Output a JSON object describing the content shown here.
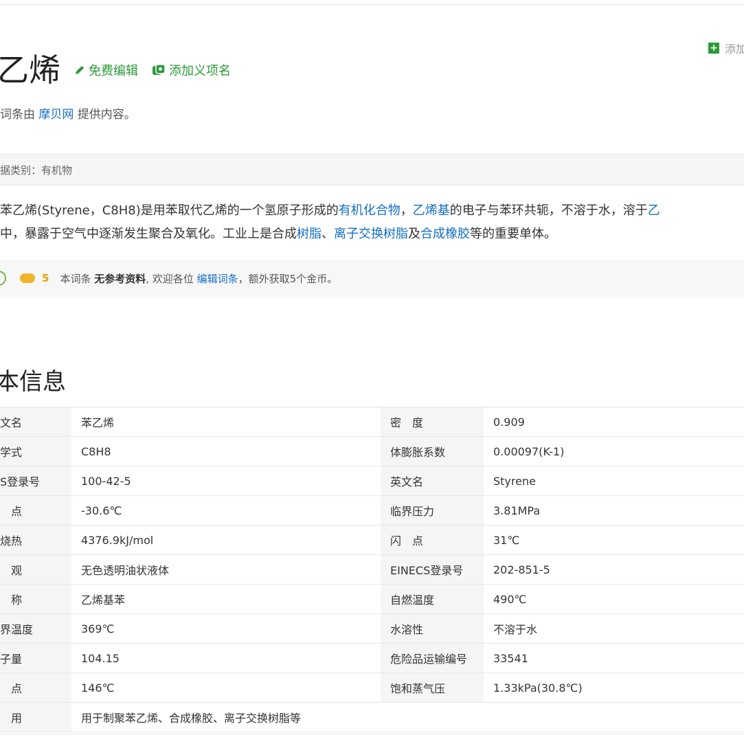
{
  "title": "乙烯",
  "actions": {
    "edit": "免费编辑",
    "add_meaning": "添加义项名"
  },
  "add_top": "添加",
  "provider": {
    "prefix": "词条由",
    "source": "摩贝网",
    "suffix": "提供内容。"
  },
  "category": "据类别：有机物",
  "summary": {
    "line1": [
      {
        "t": "苯乙烯(Styrene，C8H8)是用苯取代乙烯的一个氢原子形成的"
      },
      {
        "t": "有机化合物",
        "link": true
      },
      {
        "t": "，"
      },
      {
        "t": "乙烯基",
        "link": true
      },
      {
        "t": "的电子与苯环共轭，不溶于水，溶于"
      },
      {
        "t": "乙",
        "link": true
      }
    ],
    "line2": [
      {
        "t": "中，暴露于空气中逐渐发生聚合及氧化。工业上是合成"
      },
      {
        "t": "树脂",
        "link": true
      },
      {
        "t": "、"
      },
      {
        "t": "离子交换树脂",
        "link": true
      },
      {
        "t": "及"
      },
      {
        "t": "合成橡胶",
        "link": true
      },
      {
        "t": "等的重要单体。"
      }
    ]
  },
  "notice": {
    "coins": "5",
    "text1": "本词条",
    "bold": "无参考资料",
    "text2": ", 欢迎各位",
    "link": "编辑词条",
    "text3": "，额外获取5个金币。"
  },
  "section_title": "本信息",
  "info_rows": [
    {
      "l1": "文名",
      "v1": "苯乙烯",
      "l2": "密　度",
      "v2": "0.909"
    },
    {
      "l1": "学式",
      "v1": "C8H8",
      "l2": "体膨胀系数",
      "v2": "0.00097(K-1)"
    },
    {
      "l1": "S登录号",
      "v1": "100-42-5",
      "l2": "英文名",
      "v2": "Styrene"
    },
    {
      "l1": "　点",
      "v1": "-30.6℃",
      "l2": "临界压力",
      "v2": "3.81MPa"
    },
    {
      "l1": "烧热",
      "v1": "4376.9kJ/mol",
      "l2": "闪　点",
      "v2": "31℃"
    },
    {
      "l1": "　观",
      "v1": "无色透明油状液体",
      "l2": "EINECS登录号",
      "v2": "202-851-5"
    },
    {
      "l1": "　称",
      "v1": "乙烯基苯",
      "l2": "自燃温度",
      "v2": "490℃"
    },
    {
      "l1": "界温度",
      "v1": "369℃",
      "l2": "水溶性",
      "v2": "不溶于水"
    },
    {
      "l1": "子量",
      "v1": "104.15",
      "l2": "危险品运输编号",
      "v2": "33541"
    },
    {
      "l1": "　点",
      "v1": "146℃",
      "l2": "饱和蒸气压",
      "v2": "1.33kPa(30.8℃)"
    }
  ],
  "info_last": {
    "l1": "　用",
    "v1": "用于制聚苯乙烯、合成橡胶、离子交换树脂等"
  },
  "icons": {
    "edit": "pencil-icon",
    "add": "plus-square-icon",
    "meaning": "tag-icon",
    "coin": "coin-icon"
  },
  "colors": {
    "green": "#2c9a3a",
    "link": "#136ec2"
  }
}
